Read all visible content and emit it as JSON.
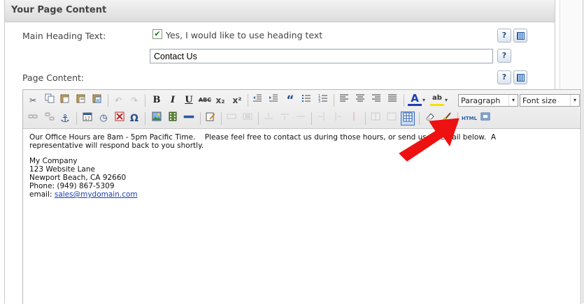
{
  "panel": {
    "title": "Your Page Content"
  },
  "form": {
    "heading_label": "Main Heading Text:",
    "checkbox_label": "Yes, I would like to use heading text",
    "checkbox_checked": true,
    "heading_value": "Contact Us",
    "content_label": "Page Content:",
    "help_symbol": "?"
  },
  "toolbar": {
    "format_select": "Paragraph",
    "fontsize_select": "Font size",
    "undo": "↶",
    "redo": "↷",
    "bold": "B",
    "italic": "I",
    "underline": "U",
    "strike": "ABC",
    "subscript": "x₂",
    "superscript": "x²",
    "blockquote": "“",
    "charmap": "Ω",
    "html": "HTML",
    "text_color": "A",
    "bg_color": "ab",
    "anchor": "⚓",
    "cut": "✂",
    "time": "◷",
    "dropdown_arrow": "▾"
  },
  "editor": {
    "paragraph1": "Our Office Hours are 8am - 5pm Pacific Time.    Please feel free to contact us during those hours, or send us an email below.  A representative will respond back to you shortly.",
    "address_lines": [
      "My Company",
      "123 Website Lane",
      "Newport Beach, CA 92660",
      "Phone: (949) 867-5309"
    ],
    "email_prefix": "email: ",
    "email_link": "sales@mydomain.com"
  },
  "colors": {
    "arrow": "#ee1111",
    "link": "#1a3fb0",
    "text_color_underline": "#1f3fb0",
    "bg_color_underline": "#f5e000"
  }
}
